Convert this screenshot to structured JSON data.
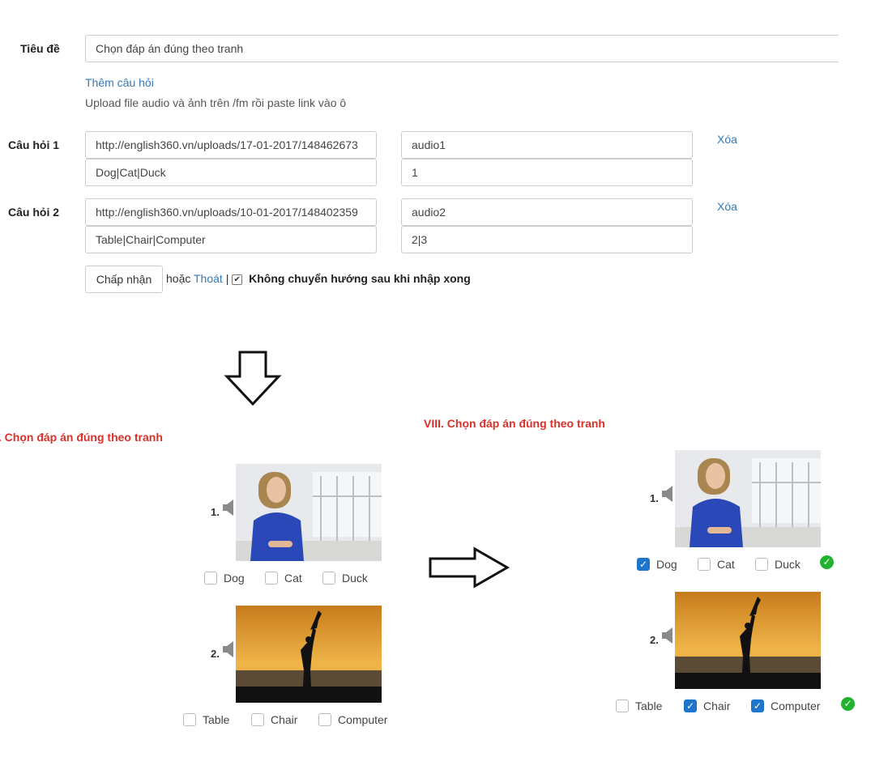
{
  "form": {
    "title_label": "Tiêu đề",
    "title_value": "Chọn đáp án đúng theo tranh",
    "add_question_link": "Thêm câu hỏi",
    "upload_hint": "Upload file audio và ảnh trên /fm rồi paste link vào ô",
    "questions": [
      {
        "label": "Câu hỏi 1",
        "image_url": "http://english360.vn/uploads/17-01-2017/148462673",
        "audio": "audio1",
        "options": "Dog|Cat|Duck",
        "answer": "1",
        "delete_label": "Xóa"
      },
      {
        "label": "Câu hỏi 2",
        "image_url": "http://english360.vn/uploads/10-01-2017/148402359",
        "audio": "audio2",
        "options": "Table|Chair|Computer",
        "answer": "2|3",
        "delete_label": "Xóa"
      }
    ],
    "accept_button": "Chấp nhận",
    "or_text": "hoặc",
    "exit_link": "Thoát",
    "separator": "|",
    "no_redirect_label": "Không chuyển hướng sau khi nhập xong",
    "no_redirect_checked": true
  },
  "preview_left": {
    "title": "I. Chọn đáp án đúng theo tranh",
    "q1": {
      "num": "1.",
      "options": [
        "Dog",
        "Cat",
        "Duck"
      ]
    },
    "q2": {
      "num": "2.",
      "options": [
        "Table",
        "Chair",
        "Computer"
      ]
    }
  },
  "preview_right": {
    "title": "VIII. Chọn đáp án đúng theo tranh",
    "q1": {
      "num": "1.",
      "options": [
        "Dog",
        "Cat",
        "Duck"
      ],
      "checked": [
        true,
        false,
        false
      ],
      "correct": true
    },
    "q2": {
      "num": "2.",
      "options": [
        "Table",
        "Chair",
        "Computer"
      ],
      "checked": [
        false,
        true,
        true
      ],
      "correct": true
    }
  },
  "colors": {
    "accent_red": "#d9312a",
    "link_blue": "#337ab7",
    "check_blue": "#1d76cc",
    "correct_green": "#22b32e"
  },
  "icons": [
    "speaker-icon",
    "down-arrow-icon",
    "right-arrow-icon",
    "correct-check-icon"
  ]
}
